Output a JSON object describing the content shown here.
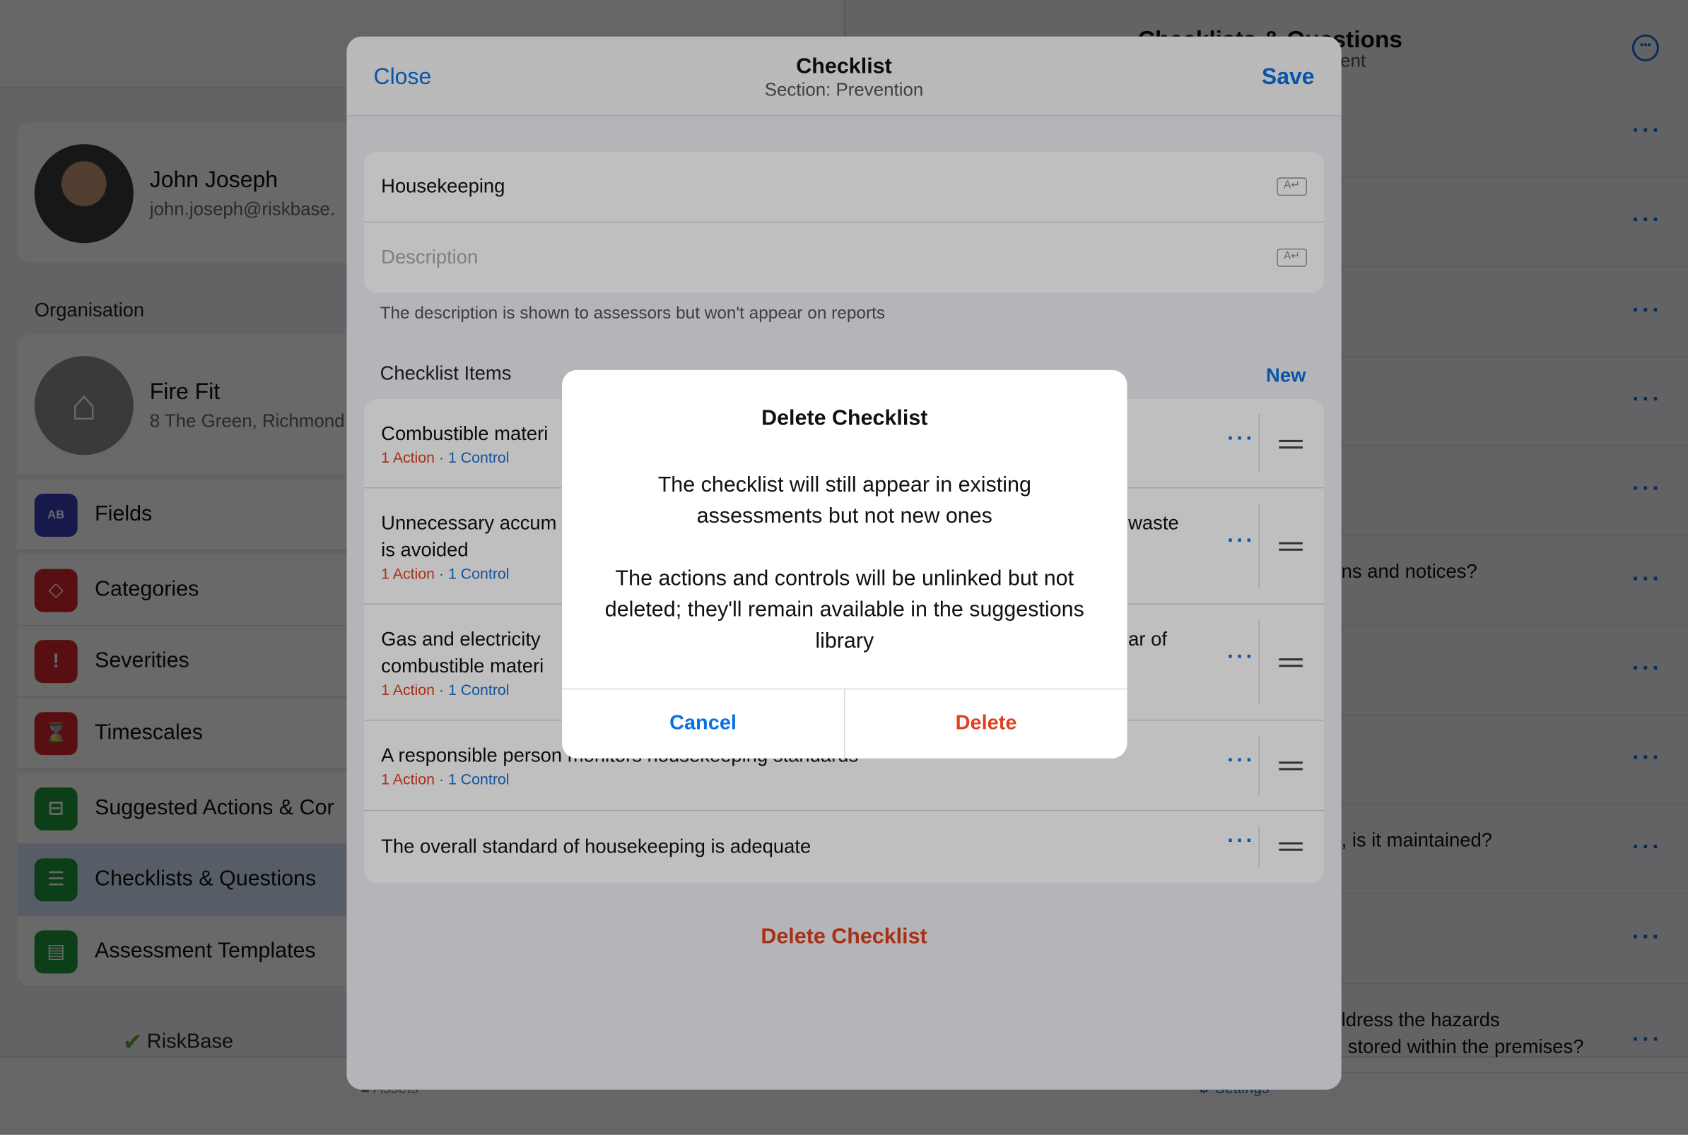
{
  "profile": {
    "name": "John Joseph",
    "email": "john.joseph@riskbase."
  },
  "organisation": {
    "heading": "Organisation",
    "name": "Fire Fit",
    "address": "8 The Green, Richmond"
  },
  "menu": [
    {
      "label": "Fields",
      "icon": "text-field-icon",
      "color": "#3b3fb6"
    },
    {
      "label": "Categories",
      "icon": "tag-icon",
      "color": "#d6262e"
    },
    {
      "label": "Severities",
      "icon": "warning-diamond-icon",
      "color": "#d6262e"
    },
    {
      "label": "Timescales",
      "icon": "hourglass-icon",
      "color": "#d6262e"
    },
    {
      "label": "Suggested Actions & Cor",
      "icon": "signpost-icon",
      "color": "#1f9a3c"
    },
    {
      "label": "Checklists & Questions",
      "icon": "checklist-icon",
      "color": "#1f9a3c",
      "selected": true
    },
    {
      "label": "Assessment Templates",
      "icon": "template-icon",
      "color": "#1f9a3c"
    }
  ],
  "logo": "RiskBase",
  "tabbar": {
    "assets": "Assets",
    "settings": "Settings"
  },
  "right_pane": {
    "title": "Checklists & Questions",
    "subtitle": "ent",
    "fragments": [
      "ns and notices?",
      ", is it maintained?",
      "ldress the hazards",
      "stored within the premises?"
    ]
  },
  "sheet": {
    "close": "Close",
    "title": "Checklist",
    "subtitle": "Section: Prevention",
    "save": "Save",
    "name_value": "Housekeeping",
    "description_placeholder": "Description",
    "hint": "The description is shown to assessors but won't appear on reports",
    "items_heading": "Checklist Items",
    "new": "New",
    "items": [
      {
        "left": "Combustible materi",
        "right": "",
        "line2": "",
        "action": "1 Action",
        "control": "1 Control"
      },
      {
        "left": "Unnecessary accum",
        "right": "waste",
        "line2": "is avoided",
        "action": "1 Action",
        "control": "1 Control"
      },
      {
        "left": "Gas and electricity",
        "right": "ar of",
        "line2": "combustible materi",
        "action": "1 Action",
        "control": "1 Control"
      },
      {
        "left": "A responsible person monitors housekeeping standards",
        "right": "",
        "line2": "",
        "action": "1 Action",
        "control": "1 Control"
      },
      {
        "left": "The overall standard of housekeeping is adequate",
        "right": "",
        "line2": "",
        "action": "",
        "control": ""
      }
    ],
    "delete_checklist": "Delete Checklist"
  },
  "alert": {
    "title": "Delete Checklist",
    "message1": "The checklist will still appear in existing assessments but not new ones",
    "message2": "The actions and controls will be unlinked but not deleted; they'll remain available in the suggestions library",
    "cancel": "Cancel",
    "delete": "Delete"
  },
  "colors": {
    "accent": "#0a72e0",
    "destructive": "#e0401e"
  }
}
